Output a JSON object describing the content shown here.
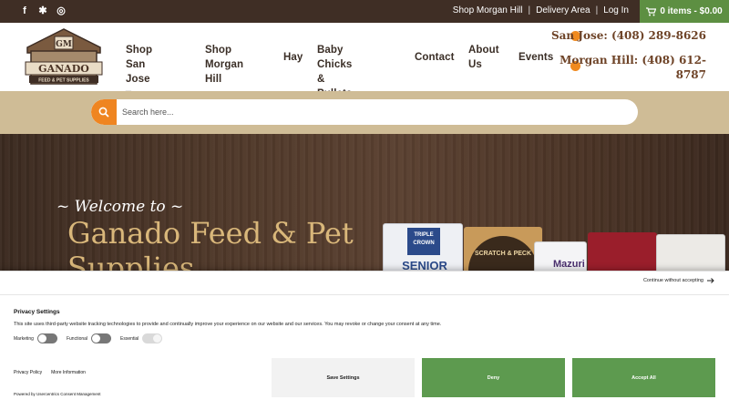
{
  "topbar": {
    "social": [
      "f",
      "yelp",
      "ig"
    ],
    "links": [
      "Shop Morgan Hill",
      "Delivery Area",
      "Log In"
    ],
    "cart": "0 items - $0.00"
  },
  "logo": {
    "name": "GANADO",
    "sub": "FEED & PET SUPPLIES",
    "mark": "GM"
  },
  "nav": {
    "items": [
      {
        "label1": "Shop San",
        "label2": "Jose ▾"
      },
      {
        "label1": "Shop Morgan",
        "label2": "Hill"
      },
      {
        "label1": "Hay",
        "label2": ""
      },
      {
        "label1": "Baby Chicks &",
        "label2": "Pullets"
      },
      {
        "label1": "Contact",
        "label2": ""
      },
      {
        "label1": "About",
        "label2": "Us"
      },
      {
        "label1": "Events",
        "label2": ""
      }
    ]
  },
  "phones": {
    "sanjose": "San Jose: (408) 289-8626",
    "morganhill_1": "Morgan Hill: (408) 612-",
    "morganhill_2": "8787"
  },
  "search": {
    "placeholder": "Search here..."
  },
  "hero": {
    "welcome": "~ Welcome to ~",
    "title": "Ganado Feed & Pet Supplies",
    "bags": [
      "TRIPLE CROWN",
      "SENIOR",
      "SCRATCH & PECK",
      "Mazuri"
    ]
  },
  "consent": {
    "continue": "Continue without accepting",
    "title": "Privacy Settings",
    "text": "This site uses third-party website tracking technologies to provide and continually improve your experience on our website and our services. You may revoke or change your consent at any time.",
    "toggles": [
      "Marketing",
      "Functional",
      "Essential"
    ],
    "links": [
      "Privacy Policy",
      "More Information"
    ],
    "powered": "Powered by Usercentrics Consent Management",
    "buttons": {
      "save": "Save Settings",
      "deny": "Deny",
      "accept": "Accept All"
    }
  },
  "colors": {
    "topbar": "#3f2e25",
    "cart": "#5d8f42",
    "accent": "#ef8521",
    "search_band": "#cfbc96",
    "title_gold": "#d9b77a",
    "consent_green": "#5d9a4f"
  }
}
